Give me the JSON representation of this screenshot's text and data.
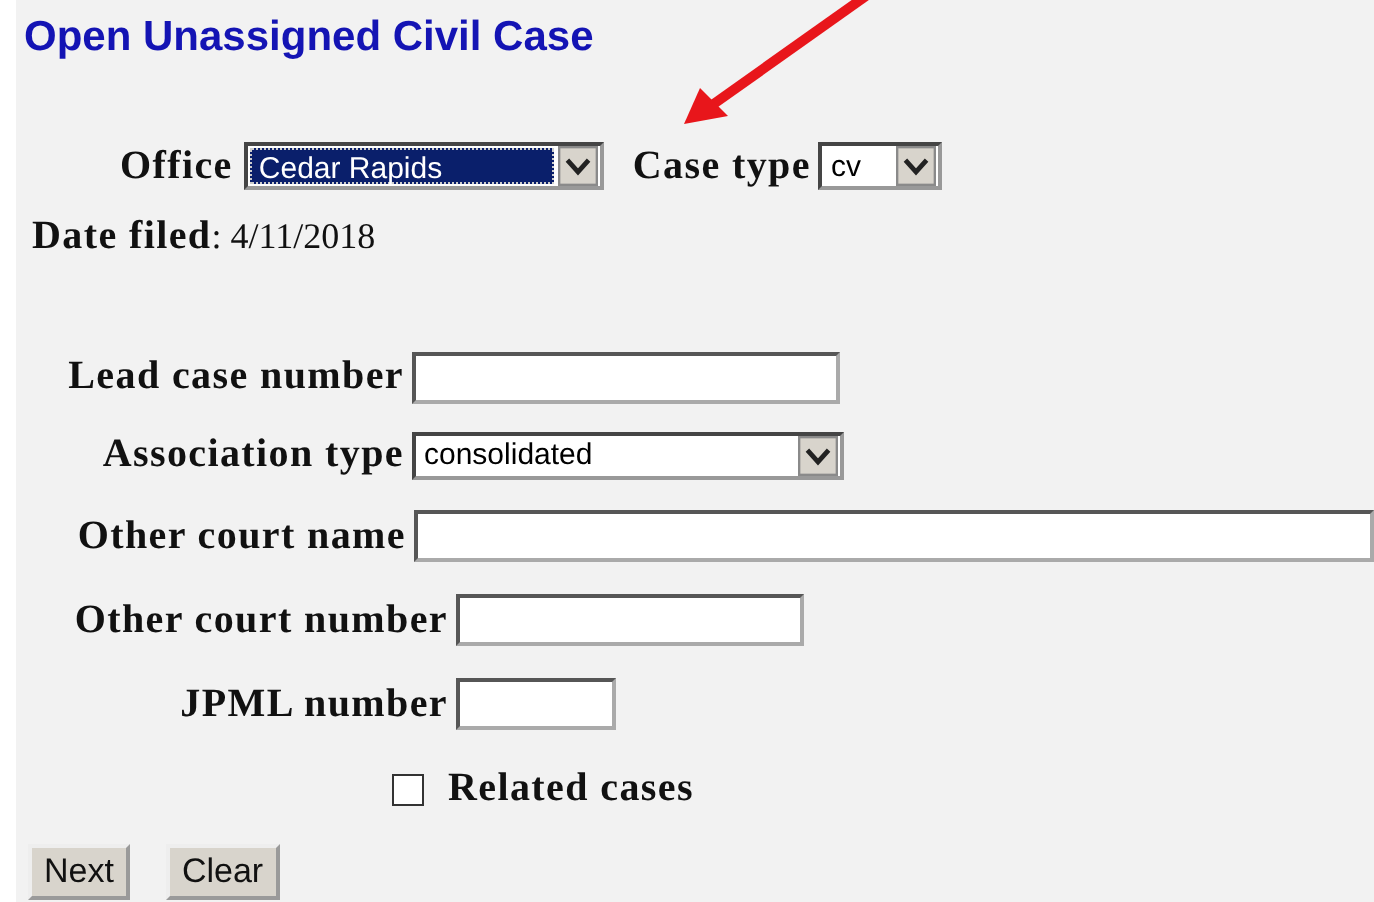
{
  "title": "Open Unassigned Civil Case",
  "office": {
    "label": "Office",
    "value": "Cedar Rapids",
    "highlighted": true
  },
  "case_type": {
    "label": "Case type",
    "value": "cv"
  },
  "date_filed": {
    "label": "Date filed",
    "separator": ":",
    "value": "4/11/2018"
  },
  "fields": [
    {
      "kind": "text",
      "label": "Lead case number"
    },
    {
      "kind": "select",
      "label": "Association type",
      "value": "consolidated"
    },
    {
      "kind": "text",
      "label": "Other court name"
    },
    {
      "kind": "text",
      "label": "Other court number"
    },
    {
      "kind": "text",
      "label": "JPML number"
    }
  ],
  "related_cases": {
    "label": "Related cases",
    "checked": false
  },
  "buttons": [
    "Next",
    "Clear"
  ]
}
